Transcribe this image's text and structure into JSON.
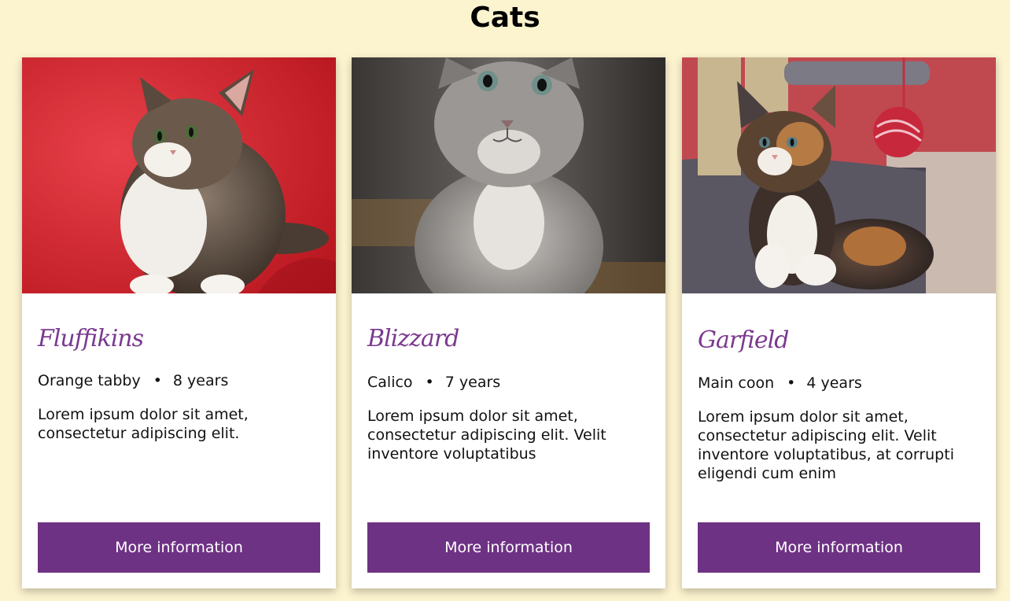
{
  "page": {
    "title": "Cats"
  },
  "theme": {
    "background": "#fcf3cf",
    "accent": "#6e3284",
    "name_color": "#7a3a8f"
  },
  "cards": [
    {
      "name": "Fluffikins",
      "breed": "Orange tabby",
      "separator": "•",
      "age": "8 years",
      "description": "Lorem ipsum dolor sit amet, consectetur adipiscing elit.",
      "button_label": "More information",
      "photo": "kitten-on-red-chair"
    },
    {
      "name": "Blizzard",
      "breed": "Calico",
      "separator": "•",
      "age": "7 years",
      "description": "Lorem ipsum dolor sit amet, consectetur adipiscing elit. Velit inventore voluptatibus",
      "button_label": "More information",
      "photo": "grey-kitten-closeup"
    },
    {
      "name": "Garfield",
      "breed": "Main coon",
      "separator": "•",
      "age": "4 years",
      "description": "Lorem ipsum dolor sit amet, consectetur adipiscing elit. Velit inventore voluptatibus, at corrupti eligendi cum enim",
      "button_label": "More information",
      "photo": "calico-kitten-with-toy"
    }
  ]
}
